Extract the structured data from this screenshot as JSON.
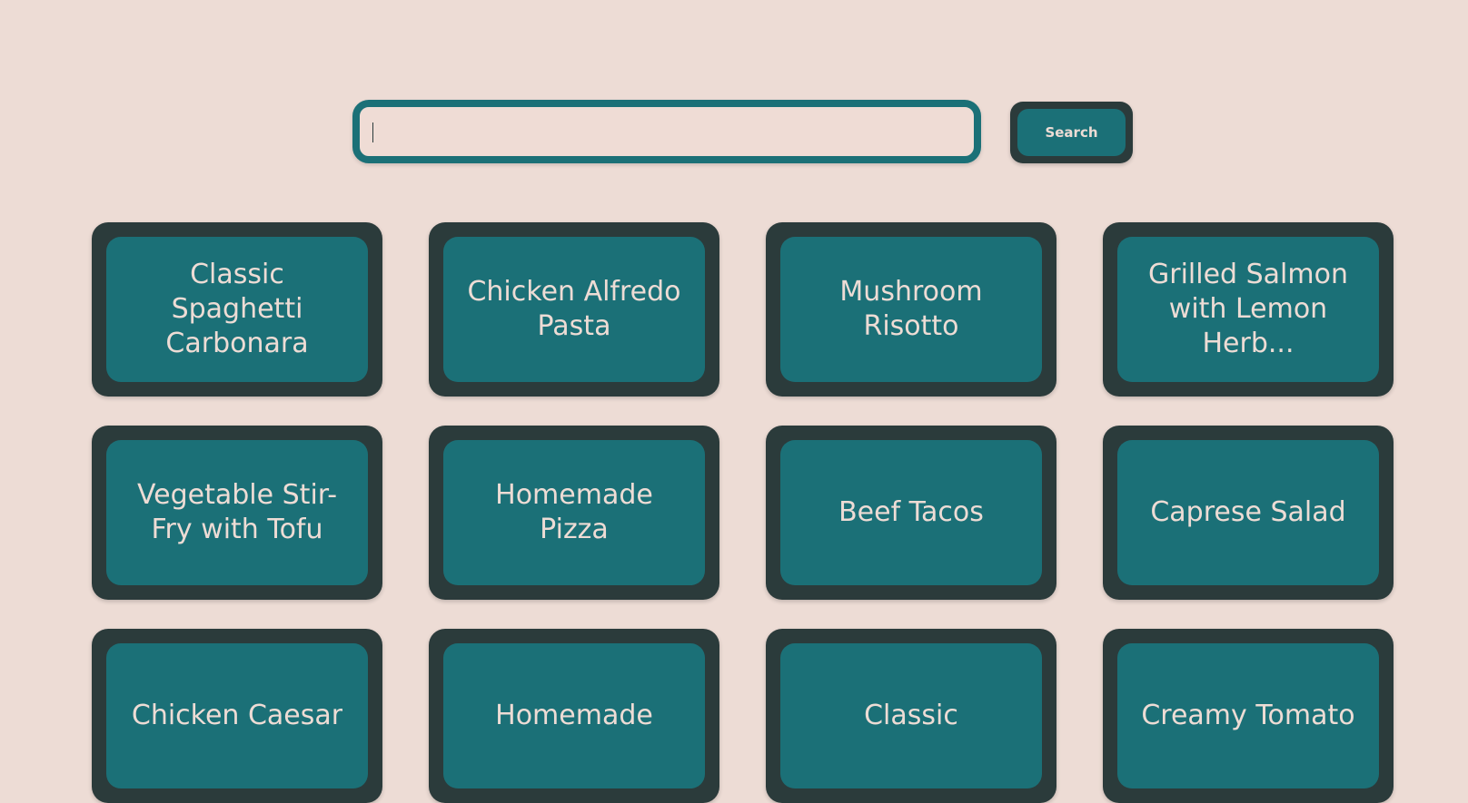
{
  "search": {
    "placeholder": "",
    "value": "",
    "button_label": "Search"
  },
  "recipes": [
    {
      "title": "Classic Spaghetti Carbonara"
    },
    {
      "title": "Chicken Alfredo Pasta"
    },
    {
      "title": "Mushroom Risotto"
    },
    {
      "title": "Grilled Salmon with Lemon Herb..."
    },
    {
      "title": "Vegetable Stir-Fry with Tofu"
    },
    {
      "title": "Homemade Pizza"
    },
    {
      "title": "Beef Tacos"
    },
    {
      "title": "Caprese Salad"
    },
    {
      "title": "Chicken Caesar"
    },
    {
      "title": "Homemade"
    },
    {
      "title": "Classic"
    },
    {
      "title": "Creamy Tomato"
    }
  ],
  "colors": {
    "background": "#eddcd5",
    "teal": "#1b7077",
    "dark": "#2b3b3b",
    "text_light": "#eddcd5"
  }
}
